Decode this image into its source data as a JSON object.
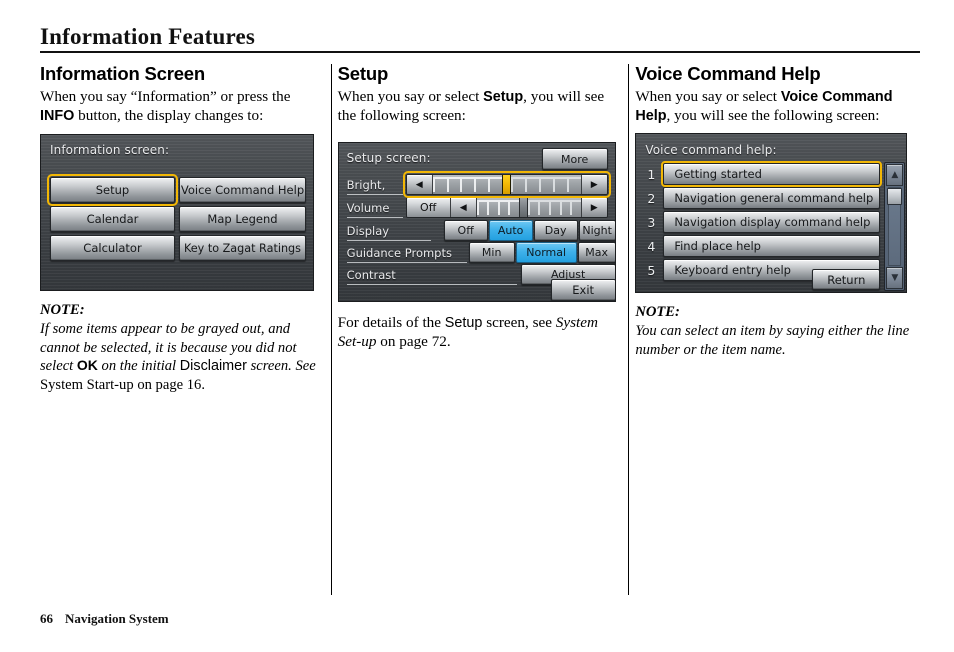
{
  "page": {
    "title": "Information Features",
    "footer_page_number": "66",
    "footer_label": "Navigation System"
  },
  "columns": {
    "information_screen": {
      "heading": "Information Screen",
      "intro_part1": "When you say “Information” or press the ",
      "intro_bold": "INFO",
      "intro_part2": " button, the display changes to:",
      "screenshot": {
        "header": "Information screen:",
        "buttons_left": [
          "Setup",
          "Calendar",
          "Calculator"
        ],
        "buttons_right": [
          "Voice Command Help",
          "Map Legend",
          "Key to Zagat Ratings"
        ],
        "selected_button": "Setup",
        "highlight_color": "#f2b705"
      },
      "note": {
        "label": "NOTE:",
        "line1": "If some items appear to be grayed out,",
        "line2": "and cannot be selected, it is because you",
        "line3_a": "did not select ",
        "line3_bold": "OK",
        "line3_b": " on the initial",
        "line4_sans": "Disclaimer",
        "line4_a": " screen. See ",
        "line4_rom": "System Start-up",
        "line5_rom": "on page 16."
      }
    },
    "setup": {
      "heading": "Setup",
      "intro_part1": "When you say or select ",
      "intro_bold": "Setup",
      "intro_part2": ", you will see the following screen:",
      "screenshot": {
        "header": "Setup screen:",
        "more_button": "More",
        "rows": [
          {
            "label": "Bright,",
            "type": "slider",
            "selected": true,
            "ticks_before": 5,
            "ticks_after": 5,
            "thumb_color": "#f2b705"
          },
          {
            "label": "Volume",
            "type": "slider_off",
            "off_label": "Off",
            "selected": false,
            "ticks_before": 4,
            "ticks_after": 5,
            "thumb_color": "#7c8186"
          },
          {
            "label": "Display",
            "type": "options",
            "options": [
              "Off",
              "Auto",
              "Day",
              "Night"
            ],
            "selected": "Auto"
          },
          {
            "label": "Guidance Prompts",
            "type": "options",
            "options": [
              "Min",
              "Normal",
              "Max"
            ],
            "selected": "Normal"
          },
          {
            "label": "Contrast",
            "type": "button",
            "button_label": "Adjust"
          }
        ],
        "exit_button": "Exit",
        "selection_color": "#3fb1ea",
        "highlight_color": "#f2b705"
      },
      "after_text_a": "For details of the ",
      "after_text_sans": "Setup",
      "after_text_b": " screen, see ",
      "after_text_italic": "System Set-up",
      "after_text_c": " on page 72."
    },
    "voice_command_help": {
      "heading": "Voice Command Help",
      "intro_part1": "When you say or select ",
      "intro_bold": "Voice Command Help",
      "intro_part2": ", you will see the following screen:",
      "screenshot": {
        "header": "Voice command help:",
        "items": [
          {
            "number": "1",
            "label": "Getting started",
            "selected": true
          },
          {
            "number": "2",
            "label": "Navigation general command help",
            "selected": false
          },
          {
            "number": "3",
            "label": "Navigation display command help",
            "selected": false
          },
          {
            "number": "4",
            "label": "Find place help",
            "selected": false
          },
          {
            "number": "5",
            "label": "Keyboard entry help",
            "selected": false
          }
        ],
        "return_button": "Return",
        "scroll_up_icon": "▲",
        "scroll_down_icon": "▼",
        "highlight_color": "#f2b705"
      },
      "note": {
        "label": "NOTE:",
        "line1": "You can select an item by saying either",
        "line2": "the line number or the item name."
      }
    }
  }
}
